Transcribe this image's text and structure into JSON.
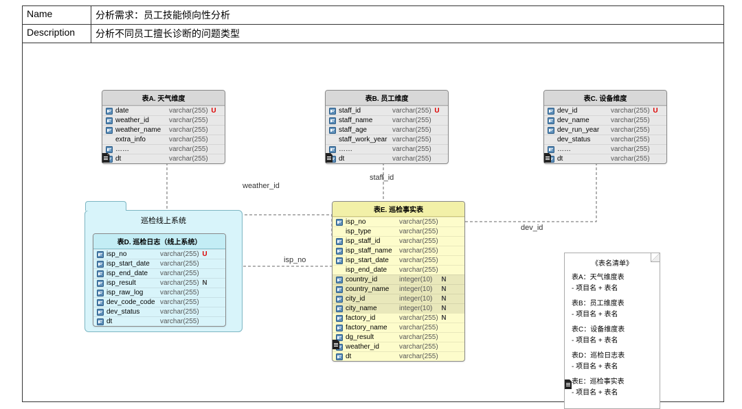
{
  "header": {
    "name_label": "Name",
    "name_value": "分析需求：员工技能倾向性分析",
    "desc_label": "Description",
    "desc_value": "分析不同员工擅长诊断的问题类型"
  },
  "tables": {
    "A": {
      "title": "表A. 天气维度",
      "rows": [
        {
          "name": "date",
          "type": "varchar(255)",
          "flag": "U",
          "icon": "key"
        },
        {
          "name": "weather_id",
          "type": "varchar(255)",
          "flag": "",
          "icon": "key"
        },
        {
          "name": "weather_name",
          "type": "varchar(255)",
          "flag": "",
          "icon": "key"
        },
        {
          "name": "extra_info",
          "type": "varchar(255)",
          "flag": "",
          "icon": "none"
        },
        {
          "name": "……",
          "type": "varchar(255)",
          "flag": "",
          "icon": "key"
        },
        {
          "name": "dt",
          "type": "varchar(255)",
          "flag": "",
          "icon": "key"
        }
      ]
    },
    "B": {
      "title": "表B. 员工维度",
      "rows": [
        {
          "name": "staff_id",
          "type": "varchar(255)",
          "flag": "U",
          "icon": "key"
        },
        {
          "name": "staff_name",
          "type": "varchar(255)",
          "flag": "",
          "icon": "key"
        },
        {
          "name": "staff_age",
          "type": "varchar(255)",
          "flag": "",
          "icon": "key"
        },
        {
          "name": "staff_work_year",
          "type": "varchar(255)",
          "flag": "",
          "icon": "none"
        },
        {
          "name": "……",
          "type": "varchar(255)",
          "flag": "",
          "icon": "key"
        },
        {
          "name": "dt",
          "type": "varchar(255)",
          "flag": "",
          "icon": "key"
        }
      ]
    },
    "C": {
      "title": "表C. 设备维度",
      "rows": [
        {
          "name": "dev_id",
          "type": "varchar(255)",
          "flag": "U",
          "icon": "key"
        },
        {
          "name": "dev_name",
          "type": "varchar(255)",
          "flag": "",
          "icon": "key"
        },
        {
          "name": "dev_run_year",
          "type": "varchar(255)",
          "flag": "",
          "icon": "key"
        },
        {
          "name": "dev_status",
          "type": "varchar(255)",
          "flag": "",
          "icon": "none"
        },
        {
          "name": "……",
          "type": "varchar(255)",
          "flag": "",
          "icon": "key"
        },
        {
          "name": "dt",
          "type": "varchar(255)",
          "flag": "",
          "icon": "key"
        }
      ]
    },
    "D": {
      "title": "表D. 巡检日志（线上系统）",
      "rows": [
        {
          "name": "isp_no",
          "type": "varchar(255)",
          "flag": "U",
          "icon": "key"
        },
        {
          "name": "isp_start_date",
          "type": "varchar(255)",
          "flag": "",
          "icon": "key"
        },
        {
          "name": "isp_end_date",
          "type": "varchar(255)",
          "flag": "",
          "icon": "key"
        },
        {
          "name": "isp_result",
          "type": "varchar(255)",
          "flag": "N",
          "icon": "key"
        },
        {
          "name": "isp_raw_log",
          "type": "varchar(255)",
          "flag": "",
          "icon": "key"
        },
        {
          "name": "dev_code_code",
          "type": "varchar(255)",
          "flag": "",
          "icon": "key"
        },
        {
          "name": "dev_status",
          "type": "varchar(255)",
          "flag": "",
          "icon": "key"
        },
        {
          "name": "dt",
          "type": "varchar(255)",
          "flag": "",
          "icon": "key"
        }
      ]
    },
    "E": {
      "title": "表E. 巡检事实表",
      "rows": [
        {
          "name": "isp_no",
          "type": "varchar(255)",
          "flag": "",
          "icon": "key",
          "shaded": false
        },
        {
          "name": "isp_type",
          "type": "varchar(255)",
          "flag": "",
          "icon": "none",
          "shaded": false
        },
        {
          "name": "isp_staff_id",
          "type": "varchar(255)",
          "flag": "",
          "icon": "key",
          "shaded": false
        },
        {
          "name": "isp_staff_name",
          "type": "varchar(255)",
          "flag": "",
          "icon": "key",
          "shaded": false
        },
        {
          "name": "isp_start_date",
          "type": "varchar(255)",
          "flag": "",
          "icon": "key",
          "shaded": false
        },
        {
          "name": "isp_end_date",
          "type": "varchar(255)",
          "flag": "",
          "icon": "none",
          "shaded": false
        },
        {
          "name": "country_id",
          "type": "integer(10)",
          "flag": "N",
          "icon": "key",
          "shaded": true
        },
        {
          "name": "country_name",
          "type": "integer(10)",
          "flag": "N",
          "icon": "key",
          "shaded": true
        },
        {
          "name": "city_id",
          "type": "integer(10)",
          "flag": "N",
          "icon": "key",
          "shaded": true
        },
        {
          "name": "city_name",
          "type": "integer(10)",
          "flag": "N",
          "icon": "key",
          "shaded": true
        },
        {
          "name": "factory_id",
          "type": "varchar(255)",
          "flag": "N",
          "icon": "key",
          "shaded": false
        },
        {
          "name": "factory_name",
          "type": "varchar(255)",
          "flag": "",
          "icon": "key",
          "shaded": false
        },
        {
          "name": "dg_result",
          "type": "varchar(255)",
          "flag": "",
          "icon": "key",
          "shaded": false
        },
        {
          "name": "weather_id",
          "type": "varchar(255)",
          "flag": "",
          "icon": "key",
          "shaded": false
        },
        {
          "name": "dt",
          "type": "varchar(255)",
          "flag": "",
          "icon": "key",
          "shaded": false
        }
      ]
    }
  },
  "folder": {
    "title": "巡检线上系统"
  },
  "edges": {
    "weather": "weather_id",
    "staff": "staff_id",
    "dev": "dev_id",
    "isp": "isp_no"
  },
  "note": {
    "title": "《表名清单》",
    "items": [
      {
        "h": "表A：天气维度表",
        "s": "- 项目名 + 表名"
      },
      {
        "h": "表B：员工维度表",
        "s": "- 项目名 + 表名"
      },
      {
        "h": "表C：设备维度表",
        "s": "- 项目名 + 表名"
      },
      {
        "h": "表D：巡检日志表",
        "s": "- 项目名 + 表名"
      },
      {
        "h": "表E：巡检事实表",
        "s": "- 项目名 + 表名"
      }
    ]
  }
}
